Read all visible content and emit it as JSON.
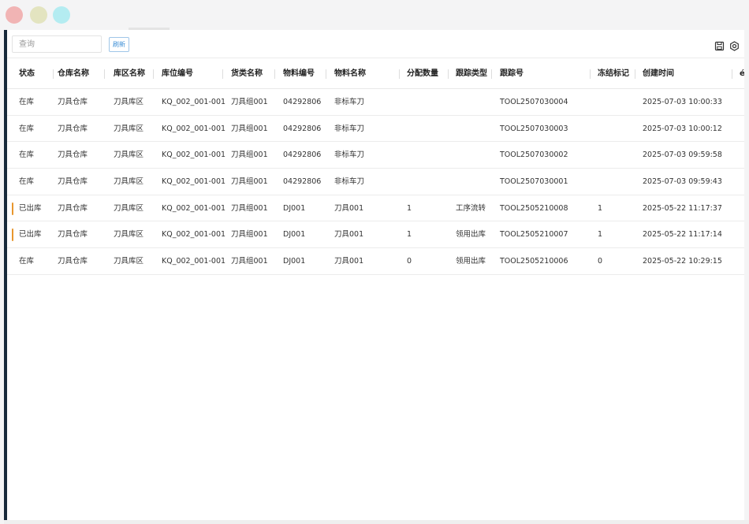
{
  "window": {
    "controls": [
      "close",
      "minimize",
      "maximize"
    ]
  },
  "toolbar": {
    "search_placeholder": "查询",
    "refresh_label": "刷新",
    "save_icon": "save-icon",
    "settings_icon": "gear-icon"
  },
  "table": {
    "headers": [
      "状态",
      "仓库名称",
      "库区名称",
      "库位编号",
      "货类名称",
      "物料编号",
      "物料名称",
      "分配数量",
      "跟踪类型",
      "跟踪号",
      "冻结标记",
      "创建时间",
      "é"
    ],
    "rows": [
      {
        "status": "在库",
        "warehouse": "刀具仓库",
        "area": "刀具库区",
        "location": "KQ_002_001-001",
        "category": "刀具组001",
        "material_code": "04292806",
        "material_name": "非标车刀",
        "qty": "",
        "track_type": "",
        "track_no": "TOOL2507030004",
        "frozen": "",
        "created": "2025-07-03 10:00:33",
        "flag": false
      },
      {
        "status": "在库",
        "warehouse": "刀具仓库",
        "area": "刀具库区",
        "location": "KQ_002_001-001",
        "category": "刀具组001",
        "material_code": "04292806",
        "material_name": "非标车刀",
        "qty": "",
        "track_type": "",
        "track_no": "TOOL2507030003",
        "frozen": "",
        "created": "2025-07-03 10:00:12",
        "flag": false
      },
      {
        "status": "在库",
        "warehouse": "刀具仓库",
        "area": "刀具库区",
        "location": "KQ_002_001-001",
        "category": "刀具组001",
        "material_code": "04292806",
        "material_name": "非标车刀",
        "qty": "",
        "track_type": "",
        "track_no": "TOOL2507030002",
        "frozen": "",
        "created": "2025-07-03 09:59:58",
        "flag": false
      },
      {
        "status": "在库",
        "warehouse": "刀具仓库",
        "area": "刀具库区",
        "location": "KQ_002_001-001",
        "category": "刀具组001",
        "material_code": "04292806",
        "material_name": "非标车刀",
        "qty": "",
        "track_type": "",
        "track_no": "TOOL2507030001",
        "frozen": "",
        "created": "2025-07-03 09:59:43",
        "flag": false
      },
      {
        "status": "已出库",
        "warehouse": "刀具仓库",
        "area": "刀具库区",
        "location": "KQ_002_001-001",
        "category": "刀具组001",
        "material_code": "DJ001",
        "material_name": "刀具001",
        "qty": "1",
        "track_type": "工序流转",
        "track_no": "TOOL2505210008",
        "frozen": "1",
        "created": "2025-05-22 11:17:37",
        "flag": true
      },
      {
        "status": "已出库",
        "warehouse": "刀具仓库",
        "area": "刀具库区",
        "location": "KQ_002_001-001",
        "category": "刀具组001",
        "material_code": "DJ001",
        "material_name": "刀具001",
        "qty": "1",
        "track_type": "领用出库",
        "track_no": "TOOL2505210007",
        "frozen": "1",
        "created": "2025-05-22 11:17:14",
        "flag": true
      },
      {
        "status": "在库",
        "warehouse": "刀具仓库",
        "area": "刀具库区",
        "location": "KQ_002_001-001",
        "category": "刀具组001",
        "material_code": "DJ001",
        "material_name": "刀具001",
        "qty": "0",
        "track_type": "领用出库",
        "track_no": "TOOL2505210006",
        "frozen": "0",
        "created": "2025-05-22 10:29:15",
        "flag": false
      }
    ]
  },
  "colors": {
    "sidebar_edge": "#17293a",
    "flag_accent": "#e8962d",
    "refresh_accent": "#3d8fd6"
  }
}
